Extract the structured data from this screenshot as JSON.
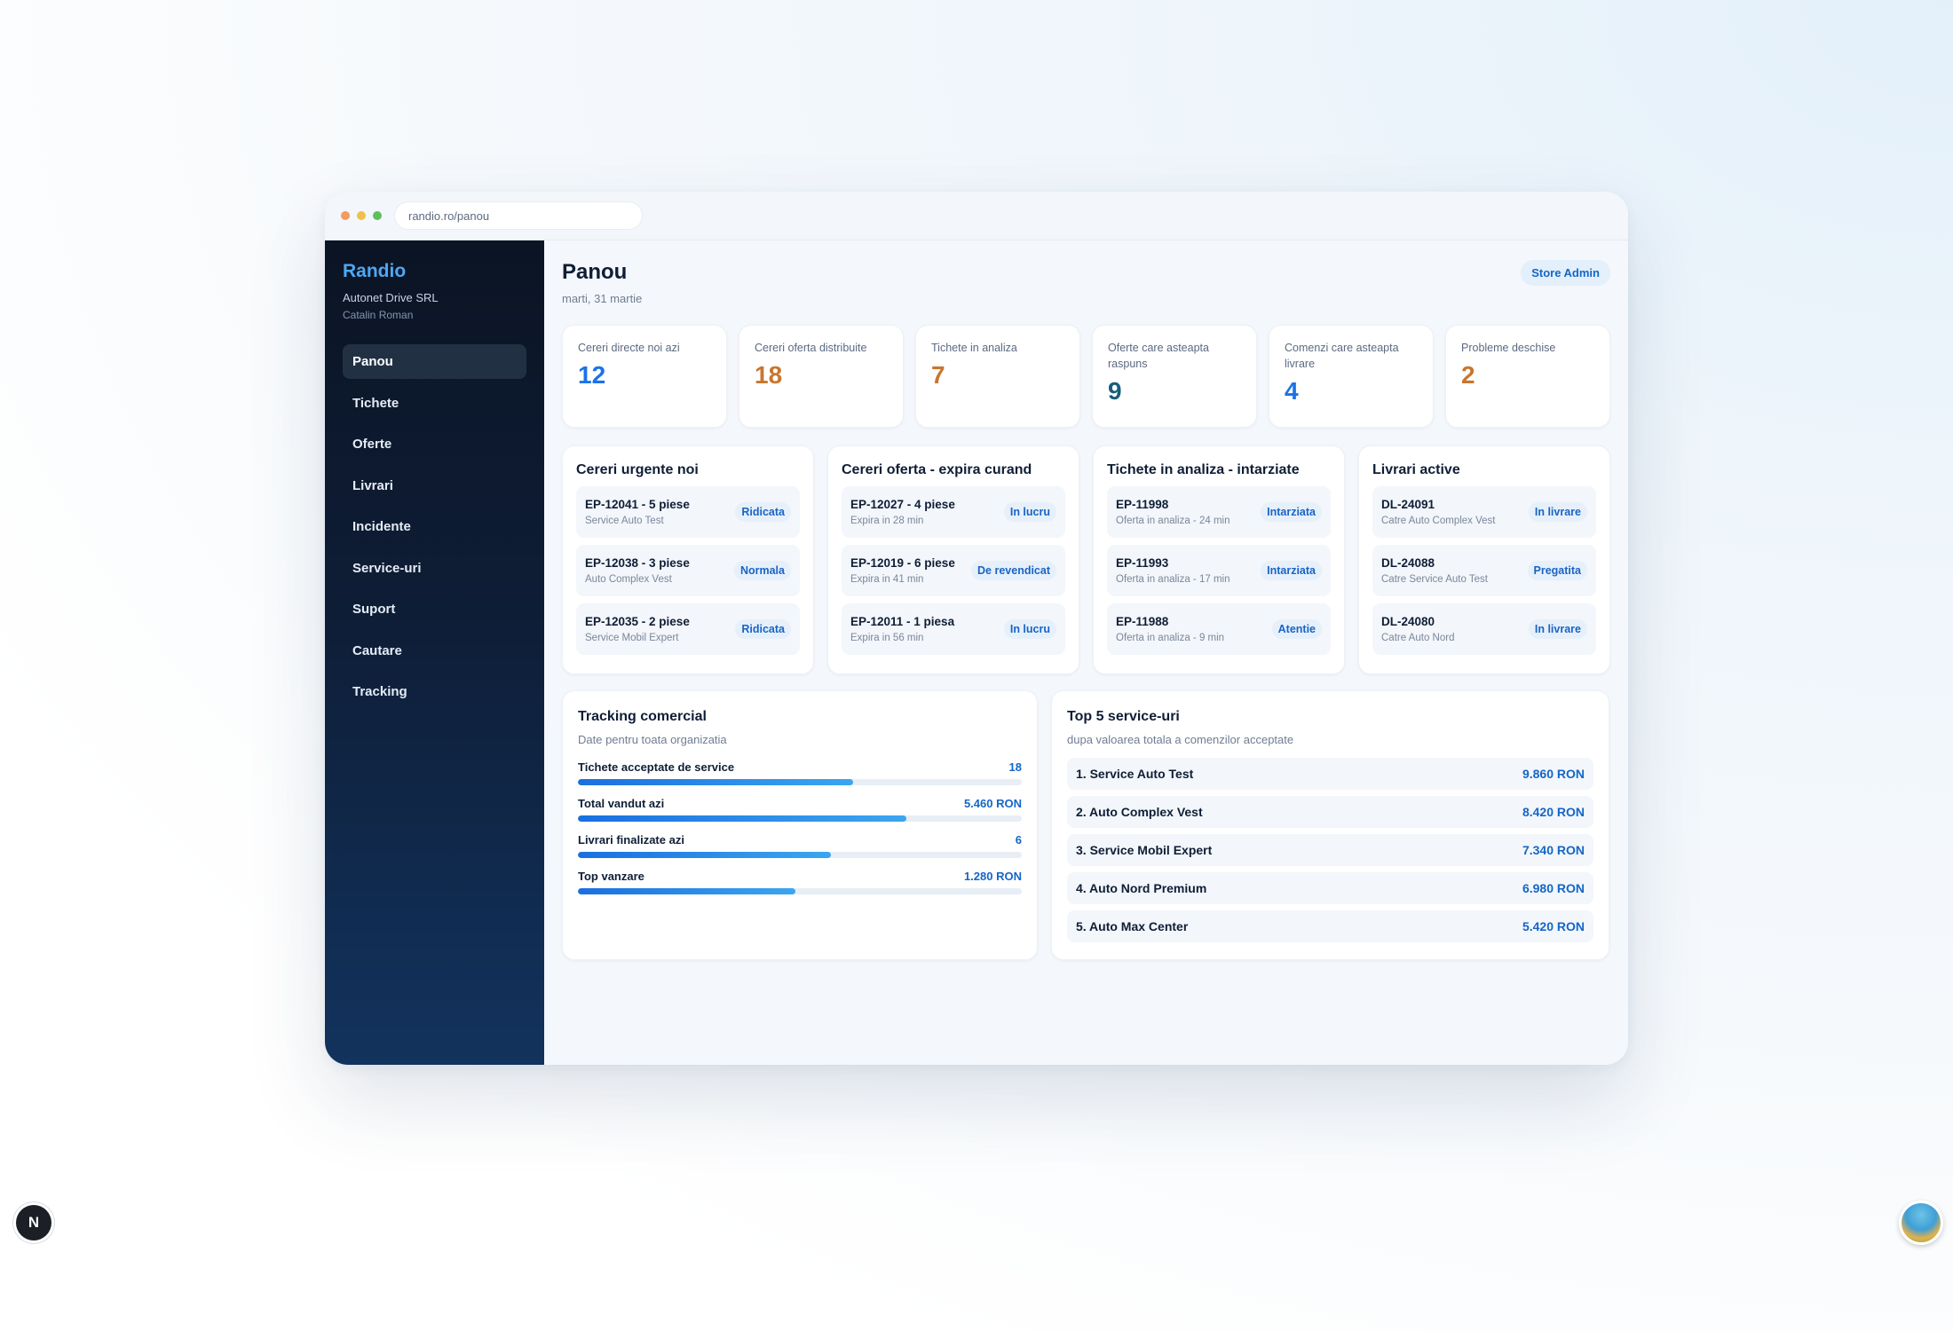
{
  "browser": {
    "url": "randio.ro/panou",
    "dots": [
      "#f29b5c",
      "#f2c04a",
      "#5fbf5b"
    ]
  },
  "sidebar": {
    "brand": "Randio",
    "company": "Autonet Drive SRL",
    "user": "Catalin Roman",
    "items": [
      {
        "label": "Panou",
        "active": true
      },
      {
        "label": "Tichete"
      },
      {
        "label": "Oferte"
      },
      {
        "label": "Livrari"
      },
      {
        "label": "Incidente"
      },
      {
        "label": "Service-uri"
      },
      {
        "label": "Suport"
      },
      {
        "label": "Cautare"
      },
      {
        "label": "Tracking"
      }
    ]
  },
  "header": {
    "title": "Panou",
    "date": "marti, 31 martie",
    "role": "Store Admin"
  },
  "stats": [
    {
      "label": "Cereri directe noi azi",
      "value": "12",
      "color": "#1a73e8"
    },
    {
      "label": "Cereri oferta distribuite",
      "value": "18",
      "color": "#c8762f"
    },
    {
      "label": "Tichete in analiza",
      "value": "7",
      "color": "#c8762f"
    },
    {
      "label": "Oferte care asteapta raspuns",
      "value": "9",
      "color": "#175e7a"
    },
    {
      "label": "Comenzi care asteapta livrare",
      "value": "4",
      "color": "#1a73e8"
    },
    {
      "label": "Probleme deschise",
      "value": "2",
      "color": "#c8762f"
    }
  ],
  "lists": [
    {
      "title": "Cereri urgente noi",
      "rows": [
        {
          "title": "EP-12041 - 5 piese",
          "sub": "Service Auto Test",
          "badge": "Ridicata"
        },
        {
          "title": "EP-12038 - 3 piese",
          "sub": "Auto Complex Vest",
          "badge": "Normala"
        },
        {
          "title": "EP-12035 - 2 piese",
          "sub": "Service Mobil Expert",
          "badge": "Ridicata"
        }
      ]
    },
    {
      "title": "Cereri oferta - expira curand",
      "rows": [
        {
          "title": "EP-12027 - 4 piese",
          "sub": "Expira in 28 min",
          "badge": "In lucru"
        },
        {
          "title": "EP-12019 - 6 piese",
          "sub": "Expira in 41 min",
          "badge": "De revendicat"
        },
        {
          "title": "EP-12011 - 1 piesa",
          "sub": "Expira in 56 min",
          "badge": "In lucru"
        }
      ]
    },
    {
      "title": "Tichete in analiza - intarziate",
      "rows": [
        {
          "title": "EP-11998",
          "sub": "Oferta in analiza - 24 min",
          "badge": "Intarziata"
        },
        {
          "title": "EP-11993",
          "sub": "Oferta in analiza - 17 min",
          "badge": "Intarziata"
        },
        {
          "title": "EP-11988",
          "sub": "Oferta in analiza - 9 min",
          "badge": "Atentie"
        }
      ]
    },
    {
      "title": "Livrari active",
      "rows": [
        {
          "title": "DL-24091",
          "sub": "Catre Auto Complex Vest",
          "badge": "In livrare"
        },
        {
          "title": "DL-24088",
          "sub": "Catre Service Auto Test",
          "badge": "Pregatita"
        },
        {
          "title": "DL-24080",
          "sub": "Catre Auto Nord",
          "badge": "In livrare"
        }
      ]
    }
  ],
  "tracking": {
    "title": "Tracking comercial",
    "subtitle": "Date pentru toata organizatia",
    "metrics": [
      {
        "label": "Tichete acceptate de service",
        "value": "18",
        "progress": 0.62
      },
      {
        "label": "Total vandut azi",
        "value": "5.460 RON",
        "progress": 0.74
      },
      {
        "label": "Livrari finalizate azi",
        "value": "6",
        "progress": 0.57
      },
      {
        "label": "Top vanzare",
        "value": "1.280 RON",
        "progress": 0.49
      }
    ]
  },
  "top": {
    "title": "Top 5 service-uri",
    "subtitle": "dupa valoarea totala a comenzilor acceptate",
    "items": [
      {
        "name": "1. Service Auto Test",
        "value": "9.860 RON"
      },
      {
        "name": "2. Auto Complex Vest",
        "value": "8.420 RON"
      },
      {
        "name": "3. Service Mobil Expert",
        "value": "7.340 RON"
      },
      {
        "name": "4. Auto Nord Premium",
        "value": "6.980 RON"
      },
      {
        "name": "5. Auto Max Center",
        "value": "5.420 RON"
      }
    ]
  },
  "overlay": {
    "next_letter": "N"
  }
}
